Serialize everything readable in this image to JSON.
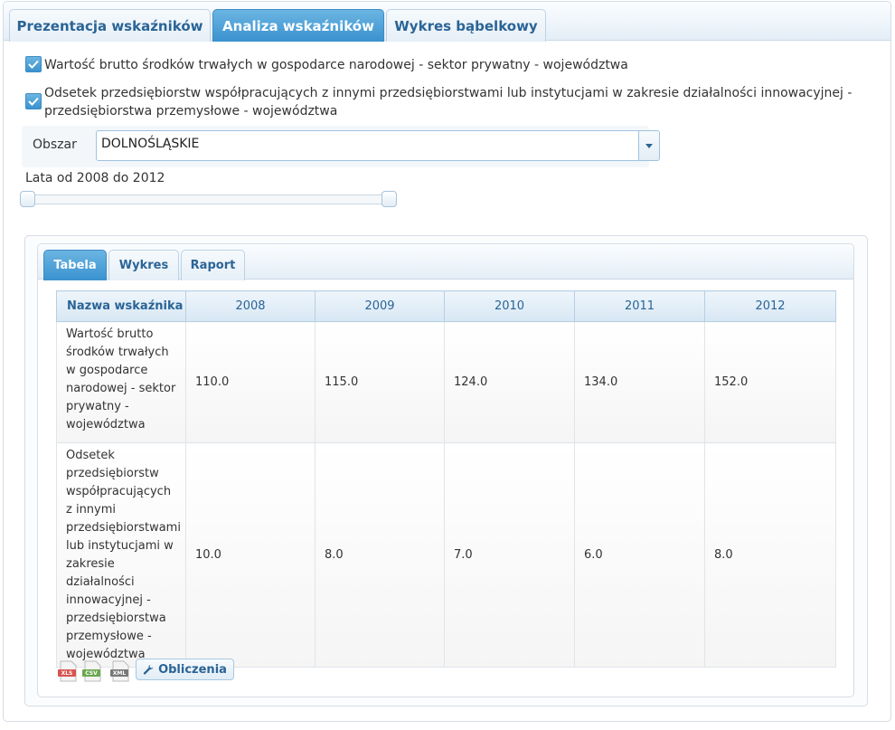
{
  "top_tabs": [
    {
      "label": "Prezentacja wskaźników",
      "active": false
    },
    {
      "label": "Analiza wskaźników",
      "active": true
    },
    {
      "label": "Wykres bąbelkowy",
      "active": false
    }
  ],
  "indicators": [
    {
      "label": "Wartość brutto środków trwałych w gospodarce narodowej - sektor prywatny - województwa",
      "checked": true
    },
    {
      "label": "Odsetek przedsiębiorstw współpracujących z innymi przedsiębiorstwami lub instytucjami w zakresie działalności innowacyjnej - przedsiębiorstwa przemysłowe - województwa",
      "checked": true
    }
  ],
  "area": {
    "label": "Obszar",
    "value": "DOLNOŚLĄSKIE"
  },
  "years": {
    "label": "Lata od 2008 do 2012",
    "from": 2008,
    "to": 2012
  },
  "inner_tabs": [
    {
      "label": "Tabela",
      "active": true
    },
    {
      "label": "Wykres",
      "active": false
    },
    {
      "label": "Raport",
      "active": false
    }
  ],
  "table": {
    "columns": [
      "Nazwa wskaźnika",
      "2008",
      "2009",
      "2010",
      "2011",
      "2012"
    ],
    "rows": [
      {
        "name": "Wartość brutto środków trwałych w gospodarce narodowej - sektor prywatny - województwa",
        "values": [
          "110.0",
          "115.0",
          "124.0",
          "134.0",
          "152.0"
        ]
      },
      {
        "name": "Odsetek przedsiębiorstw współpracujących z innymi przedsiębiorstwami lub instytucjami w zakresie działalności innowacyjnej - przedsiębiorstwa przemysłowe - województwa",
        "values": [
          "10.0",
          "8.0",
          "7.0",
          "6.0",
          "8.0"
        ]
      }
    ]
  },
  "exports": {
    "xls": "XLS",
    "csv": "CSV",
    "xml": "XML"
  },
  "calc_button": "Obliczenia",
  "colors": {
    "accent": "#3a92cf",
    "text_link": "#2a6496",
    "border": "#d6dde4"
  }
}
